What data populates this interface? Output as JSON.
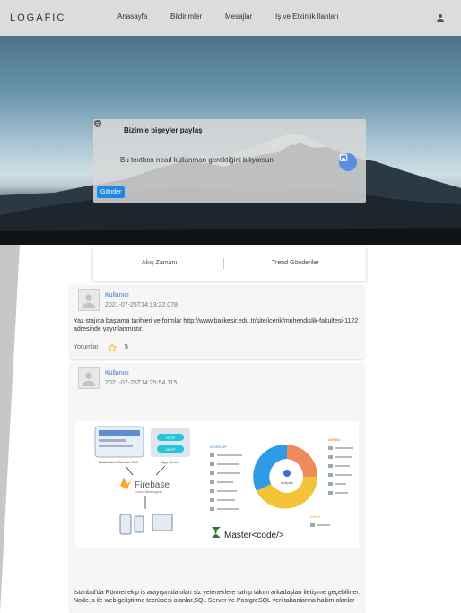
{
  "header": {
    "logo": "LOGAFIC",
    "nav": [
      "Anasayfa",
      "Bildirimler",
      "Mesajlar",
      "İş ve Etkinlik İlanları"
    ]
  },
  "composer": {
    "title": "Bizimle bişeyler paylaş",
    "textbox_value": "Bu textbox neaıl kullanman gerektiğini biliyorsun",
    "send_label": "Gönder"
  },
  "tabs": [
    "Akış Zamanı",
    "Trend Gönderiler"
  ],
  "posts": [
    {
      "author": "Kullanıcı",
      "timestamp": "2021-07-25T14:13:22.078",
      "text": "Yaz stajına başlama tarihleri ve formlar http://www.balikesir.edu.tr/site/icerik/muhendislik-fakultesi-1122 adresinde yayınlanmıştır.",
      "comments_label": "Yorumlar",
      "likes": "5"
    },
    {
      "author": "Kullanıcı",
      "timestamp": "2021-07-25T14:25:54.115",
      "image": {
        "left_caption_1": "Notification Console GUI",
        "left_caption_2": "App Server",
        "http": "HTTP",
        "xmpp": "XMPP",
        "firebase": "Firebase",
        "firebase_sub": "Cloud Messaging",
        "develop": "DEVELOP",
        "grow": "GROW",
        "earn": "EARN",
        "center": "Analytics",
        "brand": "Master<code/>"
      },
      "text": "İstanbul'da Rönnet ekip iş arayışımda olan siz yeteneklere sahip takım arkadaşları iletişime geçebilirler. Node.js ile web geliştirme tecrübesi olanlar,SQL Server ve PostgreSQL veri tabanlarına hakim olanlar"
    }
  ],
  "colors": {
    "accent": "#1e88e5",
    "navbar": "#dcdcdc",
    "link": "#3b78c2",
    "star": "#f2b705"
  }
}
